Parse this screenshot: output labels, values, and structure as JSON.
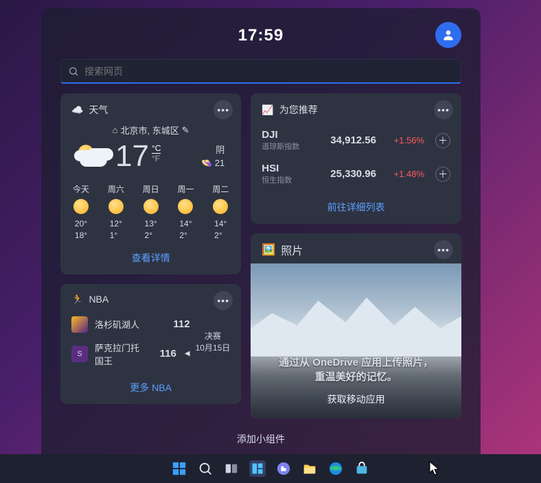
{
  "header": {
    "time": "17:59"
  },
  "search": {
    "placeholder": "搜索网页"
  },
  "weather": {
    "title": "天气",
    "location": "北京市, 东城区",
    "temp": "17",
    "unit_c": "°C",
    "unit_f": "°F",
    "cond": "阴",
    "aqi": "👒 21",
    "days": [
      {
        "label": "今天",
        "hi": "20°",
        "lo": "18°"
      },
      {
        "label": "周六",
        "hi": "12°",
        "lo": "1°"
      },
      {
        "label": "周日",
        "hi": "13°",
        "lo": "2°"
      },
      {
        "label": "周一",
        "hi": "14°",
        "lo": "2°"
      },
      {
        "label": "周二",
        "hi": "14°",
        "lo": "2°"
      }
    ],
    "details_link": "查看详情"
  },
  "nba": {
    "title": "NBA",
    "teams": [
      {
        "name": "洛杉矶湖人",
        "score": "112"
      },
      {
        "name": "萨克拉门托国王",
        "score": "116"
      }
    ],
    "stage": "决赛",
    "date": "10月15日",
    "more_link": "更多 NBA"
  },
  "stocks": {
    "title": "为您推荐",
    "rows": [
      {
        "sym": "DJI",
        "name": "道琼斯指数",
        "value": "34,912.56",
        "change": "+1.56%"
      },
      {
        "sym": "HSI",
        "name": "恒生指数",
        "value": "25,330.96",
        "change": "+1.48%"
      }
    ],
    "details_link": "前往详细列表"
  },
  "photos": {
    "title": "照片",
    "line1": "通过从 OneDrive 应用上传照片，",
    "line2": "重温美好的记忆。",
    "cta": "获取移动应用"
  },
  "footer": {
    "add_widget": "添加小组件"
  }
}
